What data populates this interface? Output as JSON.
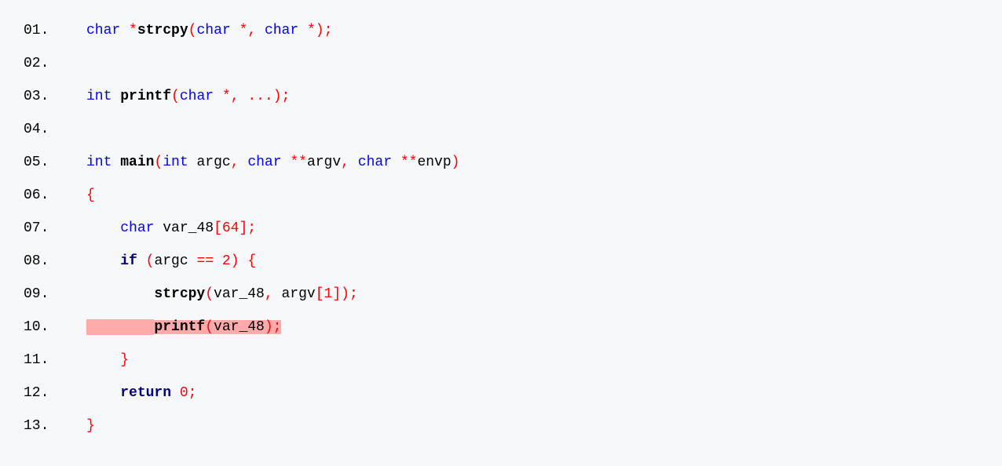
{
  "lines": [
    {
      "num": "01."
    },
    {
      "num": "02."
    },
    {
      "num": "03."
    },
    {
      "num": "04."
    },
    {
      "num": "05."
    },
    {
      "num": "06."
    },
    {
      "num": "07."
    },
    {
      "num": "08."
    },
    {
      "num": "09."
    },
    {
      "num": "10."
    },
    {
      "num": "11."
    },
    {
      "num": "12."
    },
    {
      "num": "13."
    }
  ],
  "tokens": {
    "char": "char",
    "int": "int",
    "if": "if",
    "return": "return",
    "star": "*",
    "starstar": "**",
    "strcpy": "strcpy",
    "printf": "printf",
    "main": "main",
    "lparen": "(",
    "rparen": ")",
    "lbracket": "[",
    "rbracket": "]",
    "lbrace": "{",
    "rbrace": "}",
    "comma": ",",
    "semi": ";",
    "ellipsis": "...",
    "eqeq": "==",
    "argc": "argc",
    "argv": "argv",
    "envp": "envp",
    "var_48": "var_48",
    "n64": "64",
    "n2": "2",
    "n1": "1",
    "n0": "0",
    "sp": " ",
    "indent1": "    ",
    "indent2": "        ",
    "hlpad": "        "
  }
}
